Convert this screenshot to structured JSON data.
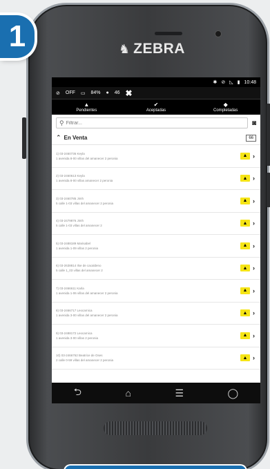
{
  "step": {
    "number": "1"
  },
  "device": {
    "brand": "ZEBRA"
  },
  "status_bar": {
    "time": "10:48"
  },
  "app_bar": {
    "gps": "OFF",
    "battery": "84%",
    "users": "46"
  },
  "tabs": [
    {
      "label": "Pendientes",
      "icon": "warning-icon"
    },
    {
      "label": "Aceptadas",
      "icon": "check-icon"
    },
    {
      "label": "Completadas",
      "icon": "tag-icon"
    }
  ],
  "search": {
    "placeholder": "Filtrar..."
  },
  "section": {
    "title": "En Venta",
    "count": "66"
  },
  "items": [
    {
      "l1": "1) 03-2460736 Keyla",
      "l2": "1 avenida 8-00 villas del amanecer 2 peronia"
    },
    {
      "l1": "2) 03-2460613 Keyla",
      "l2": "1 avenida 8-00 villas amanecer 2 peronia"
    },
    {
      "l1": "3) 03-2460785 Jimh",
      "l2": "5 calle 1-03 villas del amanecer 2 peronia"
    },
    {
      "l1": "4) 03-2479876 Jimh",
      "l2": "5 calle 1-03 villas del amanecer 2"
    },
    {
      "l1": "5) 03-2488189 Marisabel",
      "l2": "1 avenida 1-09 villas 2 peronia"
    },
    {
      "l1": "6) 03-2638814 Ilse de cacaldeno",
      "l2": "5 calle 1_03 villas del amanecer 2"
    },
    {
      "l1": "7) 03-2466611 Karla",
      "l2": "1 avenida 1-06 villas del amanecer 2 peronia"
    },
    {
      "l1": "8) 03-2466717 Leocarnica",
      "l2": "1 avenida 3-00 villas del amanecer 2 peronia"
    },
    {
      "l1": "9) 03-2488172 Leocarnica",
      "l2": "1 avenida 3-00 villas 2 peronia"
    },
    {
      "l1": "10) 03-2466762 Beatrice de Oses",
      "l2": "2 calle 0-59 villas del amanecer 2 peronia"
    }
  ],
  "colors": {
    "accent": "#1a6fb0",
    "warning": "#f5e416",
    "screen_bg": "#ffffff",
    "bar_bg": "#000000"
  }
}
